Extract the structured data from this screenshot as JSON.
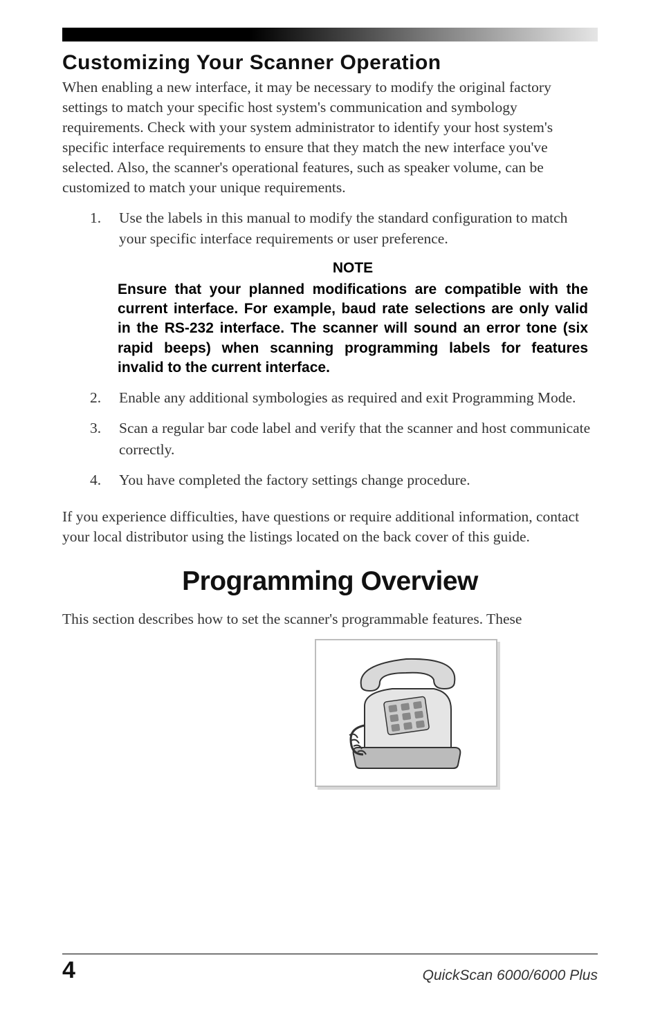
{
  "section_title": "Customizing Your Scanner Operation",
  "intro": "When enabling a new interface, it may be necessary to modify the original factory settings to match your specific host system's communication and symbology requirements.  Check with your system administrator to identify your host system's specific interface requirements to ensure that they match the new interface you've selected.  Also, the scanner's operational features, such as speaker volume, can be customized to match your unique requirements.",
  "list": {
    "item1": {
      "num": "1.",
      "text": "Use the labels in this manual to modify the standard configuration to match your specific interface requirements or user preference."
    },
    "item2": {
      "num": "2.",
      "text": "Enable any additional symbologies as required and exit Programming Mode."
    },
    "item3": {
      "num": "3.",
      "text": "Scan a regular bar code label and verify that the scanner and host communicate correctly."
    },
    "item4": {
      "num": "4.",
      "text": "You have completed the factory settings change procedure."
    }
  },
  "note": {
    "title": "NOTE",
    "body": "Ensure that your planned modifications are compatible with the current interface.  For example, baud rate selections are only valid in  the RS-232 interface.  The scanner will sound an error tone (six rapid beeps) when scanning programming labels for features invalid to the current interface."
  },
  "closing": "If you experience difficulties, have questions or require additional information, contact your local distributor using the listings located on the back cover of this guide.",
  "main_heading": "Programming Overview",
  "prog_intro": "This section describes how to set the scanner's programmable features.  These",
  "image_name": "telephone-illustration",
  "footer": {
    "page_number": "4",
    "product_name": "QuickScan 6000/6000 Plus"
  }
}
